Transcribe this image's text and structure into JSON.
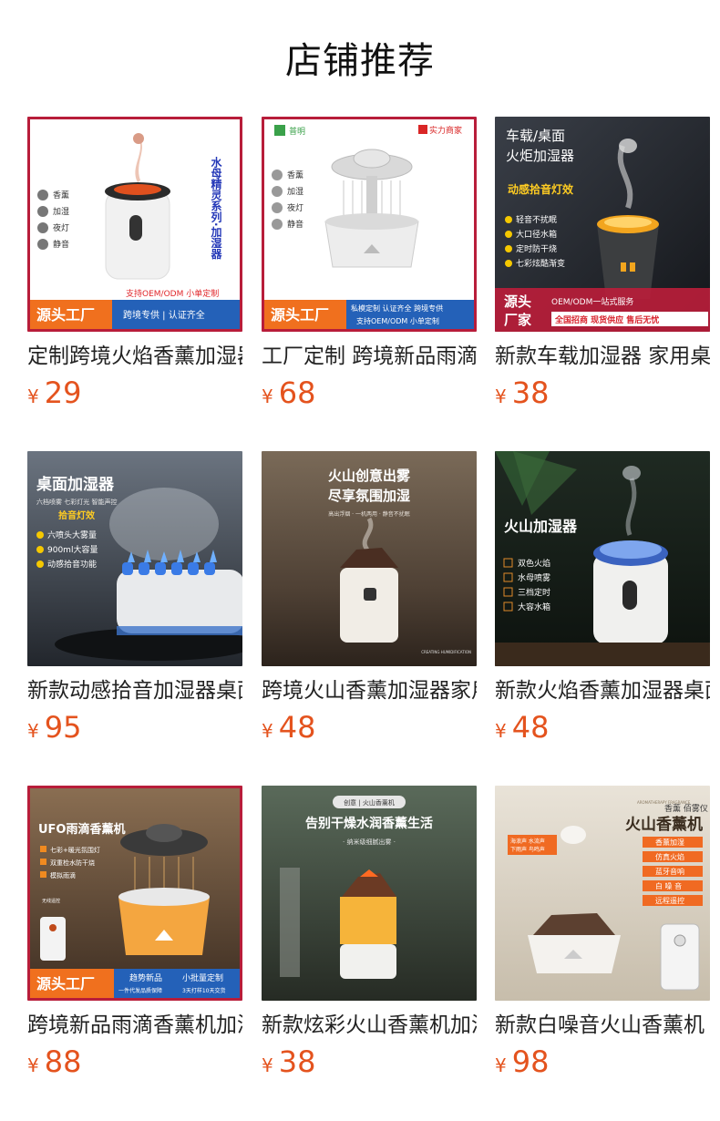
{
  "page": {
    "title": "店铺推荐"
  },
  "currency_symbol": "¥",
  "products": [
    {
      "name": "定制跨境火焰香薰加湿器",
      "price": "29",
      "image_text": {
        "vertical": "水母精灵系列·加湿器",
        "features": [
          "香薰",
          "加湿",
          "夜灯",
          "静音"
        ],
        "badge": "支持OEM/ODM 小单定制",
        "banner": "源头工厂",
        "banner_sub": "跨境专供 | 认证齐全"
      }
    },
    {
      "name": "工厂定制 跨境新品雨滴加湿器",
      "price": "68",
      "image_text": {
        "brand": "普明",
        "tag": "实力商家",
        "features": [
          "香薰",
          "加湿",
          "夜灯",
          "静音"
        ],
        "banner": "源头工厂",
        "banner_sub1": "私模定制 认证齐全 跨境专供",
        "banner_sub2": "支持OEM/ODM 小单定制"
      }
    },
    {
      "name": "新款车载加湿器 家用桌面",
      "price": "38",
      "image_text": {
        "headline1": "车载/桌面",
        "headline2": "火炬加湿器",
        "rainbow": "动感拾音灯效",
        "features": [
          "轻音不扰眠",
          "大口径水箱",
          "定时防干烧",
          "七彩炫酷渐变"
        ],
        "banner1": "源头",
        "banner2": "厂家",
        "service": "OEM/ODM一站式服务",
        "service2": "全国招商 现货供应 售后无忧"
      }
    },
    {
      "name": "新款动感拾音加湿器桌面",
      "price": "95",
      "image_text": {
        "headline": "桌面加湿器",
        "sub": "六档喷雾 七彩灯光 智能声控",
        "rainbow": "拾音灯效",
        "features": [
          "六喷头大雾量",
          "900ml大容量",
          "动感拾音功能"
        ]
      }
    },
    {
      "name": "跨境火山香薰加湿器家用",
      "price": "48",
      "image_text": {
        "headline1": "火山创意出雾",
        "headline2": "尽享氛围加湿",
        "sub": "高出浮烟 · 一机两用 · 静音不扰眠",
        "corner": "CREATING HUMIDIFICATION"
      }
    },
    {
      "name": "新款火焰香薰加湿器桌面",
      "price": "48",
      "image_text": {
        "headline": "火山加湿器",
        "features": [
          "双色火焰",
          "水母喷雾",
          "三档定时",
          "大容水箱"
        ]
      }
    },
    {
      "name": "跨境新品雨滴香薰机加湿器",
      "price": "88",
      "image_text": {
        "headline": "UFO雨滴香薰机",
        "features": [
          "七彩+暖光氛围灯",
          "双重检水防干烧",
          "模拟雨滴"
        ],
        "remote_label": "无线遥控",
        "banner": "源头工厂",
        "banner_sub1": "趋势新品",
        "banner_sub2": "一件代发品质保障",
        "banner_sub3": "小批量定制",
        "banner_sub4": "3天打样10天交货"
      }
    },
    {
      "name": "新款炫彩火山香薰机加湿器",
      "price": "38",
      "image_text": {
        "pill": "创意 | 火山香薰机",
        "headline": "告别干燥水润香薰生活",
        "sub": "· 纳米级细腻出雾 ·"
      }
    },
    {
      "name": "新款白噪音火山香薰机",
      "price": "98",
      "image_text": {
        "small_en": "AROMATHERAPY FRAGRANCE",
        "small_cn": "香薰 佰雾仪",
        "headline": "火山香薰机",
        "sounds1": "海浪声 水流声",
        "sounds2": "下雨声 鸟鸣声",
        "features": [
          "香薰加湿",
          "仿真火焰",
          "蓝牙音响",
          "白 噪 音",
          "远程遥控"
        ]
      }
    }
  ]
}
